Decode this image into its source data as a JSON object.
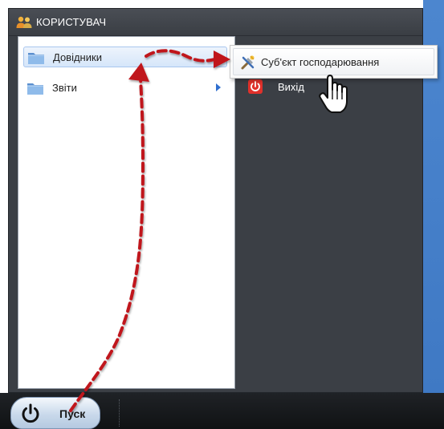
{
  "start_menu": {
    "title": "КОРИСТУВАЧ",
    "left_items": [
      {
        "label": "Довідники",
        "icon": "folder-icon",
        "has_submenu": true,
        "selected": true
      },
      {
        "label": "Звіти",
        "icon": "folder-icon",
        "has_submenu": true,
        "selected": false
      }
    ],
    "exit": {
      "label": "Вихід",
      "icon": "power-icon"
    }
  },
  "submenu": {
    "items": [
      {
        "label": "Суб'єкт господарювання",
        "icon": "tools-icon"
      }
    ]
  },
  "taskbar": {
    "start_label": "Пуск",
    "start_icon": "power-icon"
  },
  "colors": {
    "menu_bg": "#3b3f45",
    "selection": "#d6e6fa",
    "arrow_accent": "#2f6fcf",
    "annotation_red": "#c0141c",
    "desktop_blue": "#4680cb"
  }
}
